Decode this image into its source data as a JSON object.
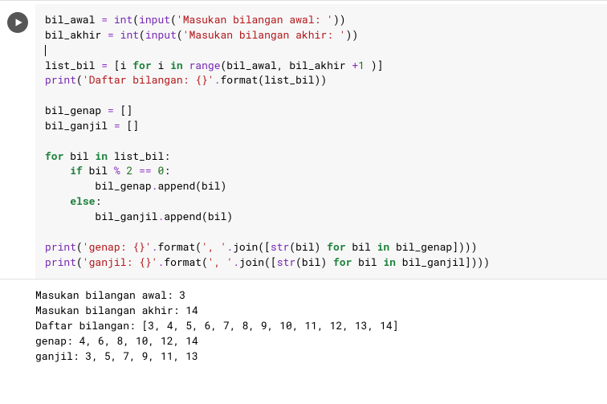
{
  "code": {
    "lines": [
      [
        {
          "t": "plain",
          "v": "bil_awal "
        },
        {
          "t": "op",
          "v": "="
        },
        {
          "t": "plain",
          "v": " "
        },
        {
          "t": "bi",
          "v": "int"
        },
        {
          "t": "plain",
          "v": "("
        },
        {
          "t": "bi",
          "v": "input"
        },
        {
          "t": "plain",
          "v": "("
        },
        {
          "t": "str",
          "v": "'Masukan bilangan awal: '"
        },
        {
          "t": "plain",
          "v": "))"
        }
      ],
      [
        {
          "t": "plain",
          "v": "bil_akhir "
        },
        {
          "t": "op",
          "v": "="
        },
        {
          "t": "plain",
          "v": " "
        },
        {
          "t": "bi",
          "v": "int"
        },
        {
          "t": "plain",
          "v": "("
        },
        {
          "t": "bi",
          "v": "input"
        },
        {
          "t": "plain",
          "v": "("
        },
        {
          "t": "str",
          "v": "'Masukan bilangan akhir: '"
        },
        {
          "t": "plain",
          "v": "))"
        }
      ],
      [
        {
          "t": "cursor",
          "v": ""
        }
      ],
      [
        {
          "t": "plain",
          "v": "list_bil "
        },
        {
          "t": "op",
          "v": "="
        },
        {
          "t": "plain",
          "v": " [i "
        },
        {
          "t": "kw",
          "v": "for"
        },
        {
          "t": "plain",
          "v": " i "
        },
        {
          "t": "kw",
          "v": "in"
        },
        {
          "t": "plain",
          "v": " "
        },
        {
          "t": "bi",
          "v": "range"
        },
        {
          "t": "plain",
          "v": "(bil_awal, bil_akhir "
        },
        {
          "t": "op",
          "v": "+"
        },
        {
          "t": "num",
          "v": "1"
        },
        {
          "t": "plain",
          "v": " )]"
        }
      ],
      [
        {
          "t": "bi",
          "v": "print"
        },
        {
          "t": "plain",
          "v": "("
        },
        {
          "t": "str",
          "v": "'Daftar bilangan: {}'"
        },
        {
          "t": "op",
          "v": "."
        },
        {
          "t": "plain",
          "v": "format(list_bil))"
        }
      ],
      [
        {
          "t": "plain",
          "v": ""
        }
      ],
      [
        {
          "t": "plain",
          "v": "bil_genap "
        },
        {
          "t": "op",
          "v": "="
        },
        {
          "t": "plain",
          "v": " []"
        }
      ],
      [
        {
          "t": "plain",
          "v": "bil_ganjil "
        },
        {
          "t": "op",
          "v": "="
        },
        {
          "t": "plain",
          "v": " []"
        }
      ],
      [
        {
          "t": "plain",
          "v": ""
        }
      ],
      [
        {
          "t": "kw",
          "v": "for"
        },
        {
          "t": "plain",
          "v": " bil "
        },
        {
          "t": "kw",
          "v": "in"
        },
        {
          "t": "plain",
          "v": " list_bil:"
        }
      ],
      [
        {
          "t": "plain",
          "v": "    "
        },
        {
          "t": "kw",
          "v": "if"
        },
        {
          "t": "plain",
          "v": " bil "
        },
        {
          "t": "op",
          "v": "%"
        },
        {
          "t": "plain",
          "v": " "
        },
        {
          "t": "num",
          "v": "2"
        },
        {
          "t": "plain",
          "v": " "
        },
        {
          "t": "op",
          "v": "=="
        },
        {
          "t": "plain",
          "v": " "
        },
        {
          "t": "num",
          "v": "0"
        },
        {
          "t": "plain",
          "v": ":"
        }
      ],
      [
        {
          "t": "plain",
          "v": "        bil_genap"
        },
        {
          "t": "op",
          "v": "."
        },
        {
          "t": "plain",
          "v": "append(bil)"
        }
      ],
      [
        {
          "t": "plain",
          "v": "    "
        },
        {
          "t": "kw",
          "v": "else"
        },
        {
          "t": "plain",
          "v": ":"
        }
      ],
      [
        {
          "t": "plain",
          "v": "        bil_ganjil"
        },
        {
          "t": "op",
          "v": "."
        },
        {
          "t": "plain",
          "v": "append(bil)"
        }
      ],
      [
        {
          "t": "plain",
          "v": ""
        }
      ],
      [
        {
          "t": "bi",
          "v": "print"
        },
        {
          "t": "plain",
          "v": "("
        },
        {
          "t": "str",
          "v": "'genap: {}'"
        },
        {
          "t": "op",
          "v": "."
        },
        {
          "t": "plain",
          "v": "format("
        },
        {
          "t": "str",
          "v": "', '"
        },
        {
          "t": "op",
          "v": "."
        },
        {
          "t": "plain",
          "v": "join(["
        },
        {
          "t": "bi",
          "v": "str"
        },
        {
          "t": "plain",
          "v": "(bil) "
        },
        {
          "t": "kw",
          "v": "for"
        },
        {
          "t": "plain",
          "v": " bil "
        },
        {
          "t": "kw",
          "v": "in"
        },
        {
          "t": "plain",
          "v": " bil_genap])))"
        }
      ],
      [
        {
          "t": "bi",
          "v": "print"
        },
        {
          "t": "plain",
          "v": "("
        },
        {
          "t": "str",
          "v": "'ganjil: {}'"
        },
        {
          "t": "op",
          "v": "."
        },
        {
          "t": "plain",
          "v": "format("
        },
        {
          "t": "str",
          "v": "', '"
        },
        {
          "t": "op",
          "v": "."
        },
        {
          "t": "plain",
          "v": "join(["
        },
        {
          "t": "bi",
          "v": "str"
        },
        {
          "t": "plain",
          "v": "(bil) "
        },
        {
          "t": "kw",
          "v": "for"
        },
        {
          "t": "plain",
          "v": " bil "
        },
        {
          "t": "kw",
          "v": "in"
        },
        {
          "t": "plain",
          "v": " bil_ganjil])))"
        }
      ]
    ]
  },
  "output": {
    "lines": [
      "Masukan bilangan awal: 3",
      "Masukan bilangan akhir: 14",
      "Daftar bilangan: [3, 4, 5, 6, 7, 8, 9, 10, 11, 12, 13, 14]",
      "genap: 4, 6, 8, 10, 12, 14",
      "ganjil: 3, 5, 7, 9, 11, 13"
    ]
  }
}
